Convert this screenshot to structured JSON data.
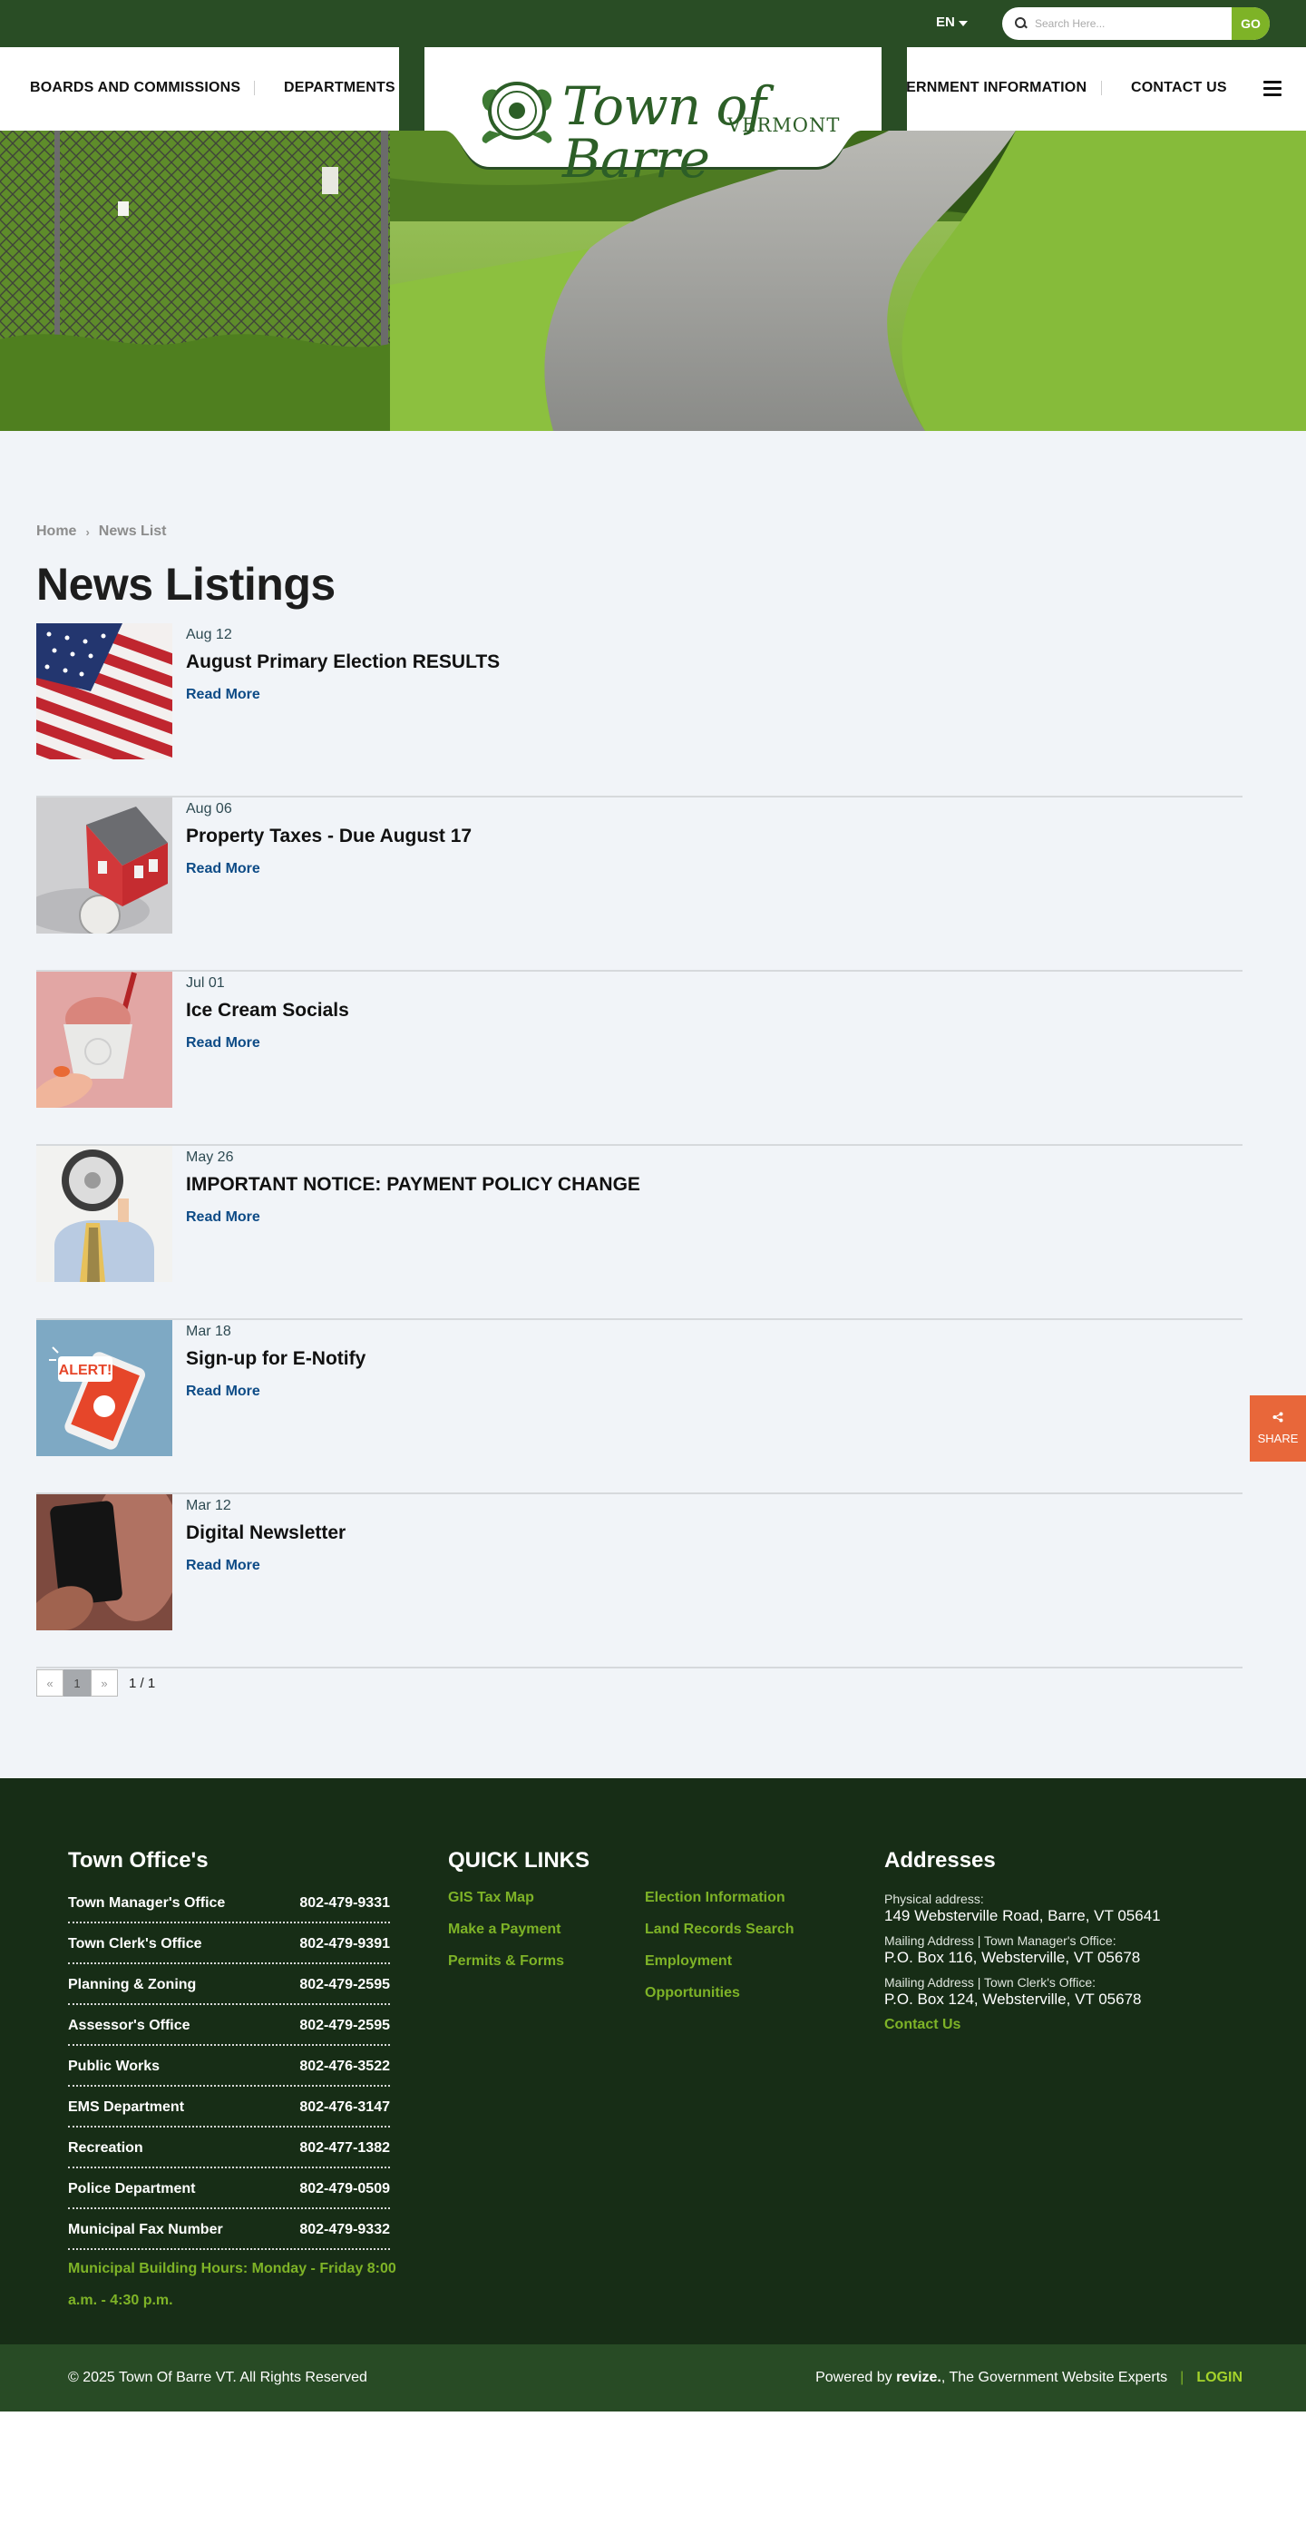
{
  "topbar": {
    "language": "EN",
    "search_placeholder": "Search Here...",
    "go_label": "GO"
  },
  "nav": {
    "left": [
      "BOARDS AND COMMISSIONS",
      "DEPARTMENTS"
    ],
    "right": [
      "GOVERNMENT INFORMATION",
      "CONTACT US"
    ],
    "logo_title": "Town of Barre",
    "logo_sub": "VERMONT"
  },
  "breadcrumb": {
    "home": "Home",
    "current": "News List"
  },
  "page_title": "News Listings",
  "news": [
    {
      "date": "Aug 12",
      "title": "August Primary Election RESULTS",
      "more": "Read More",
      "thumb_icon": "american-flag-image"
    },
    {
      "date": "Aug 06",
      "title": "Property Taxes - Due August 17",
      "more": "Read More",
      "thumb_icon": "house-model-image"
    },
    {
      "date": "Jul 01",
      "title": "Ice Cream Socials",
      "more": "Read More",
      "thumb_icon": "ice-cream-cup-image"
    },
    {
      "date": "May 26",
      "title": "IMPORTANT NOTICE: PAYMENT POLICY CHANGE",
      "more": "Read More",
      "thumb_icon": "megaphone-image"
    },
    {
      "date": "Mar 18",
      "title": "Sign-up for E-Notify",
      "more": "Read More",
      "thumb_icon": "alert-phone-image"
    },
    {
      "date": "Mar 12",
      "title": "Digital Newsletter",
      "more": "Read More",
      "thumb_icon": "smartphone-image"
    }
  ],
  "pagination": {
    "prev": "«",
    "current": "1",
    "next": "»",
    "count": "1 / 1"
  },
  "share": {
    "label": "SHARE"
  },
  "footer": {
    "office_heading": "Town Office's",
    "offices": [
      {
        "name": "Town Manager's Office",
        "phone": "802-479-9331"
      },
      {
        "name": "Town Clerk's Office",
        "phone": "802-479-9391"
      },
      {
        "name": "Planning & Zoning",
        "phone": "802-479-2595"
      },
      {
        "name": "Assessor's Office",
        "phone": "802-479-2595"
      },
      {
        "name": "Public Works",
        "phone": "802-476-3522"
      },
      {
        "name": "EMS Department",
        "phone": "802-476-3147"
      },
      {
        "name": "Recreation",
        "phone": "802-477-1382"
      },
      {
        "name": "Police Department",
        "phone": "802-479-0509"
      },
      {
        "name": "Municipal Fax Number",
        "phone": "802-479-9332"
      }
    ],
    "hours": "Municipal Building Hours:  Monday - Friday 8:00 a.m. - 4:30 p.m.",
    "quick_links_heading": "QUICK LINKS",
    "quick_links_col1": [
      "GIS Tax Map",
      "Make a Payment",
      "Permits & Forms"
    ],
    "quick_links_col2": [
      "Election Information",
      "Land Records Search",
      "Employment",
      "Opportunities"
    ],
    "addresses_heading": "Addresses",
    "addresses": [
      {
        "label": "Physical address:",
        "value": "149 Websterville Road, Barre, VT 05641"
      },
      {
        "label": "Mailing Address | Town Manager's Office:",
        "value": "P.O. Box 116, Websterville, VT 05678"
      },
      {
        "label": "Mailing Address | Town Clerk's Office:",
        "value": "P.O. Box 124, Websterville, VT 05678"
      }
    ],
    "contact_link": "Contact Us",
    "copyright": "© 2025 Town Of Barre VT. All Rights Reserved",
    "powered_prefix": "Powered by",
    "powered_brand": "revize.",
    "powered_suffix": ", The Government Website Experts",
    "divider": "|",
    "login": "LOGIN"
  },
  "colors": {
    "topbar": "#294d25",
    "accent_green": "#7eb327",
    "footer": "#172d16",
    "share": "#e8673a",
    "link_blue": "#0d4b86"
  }
}
